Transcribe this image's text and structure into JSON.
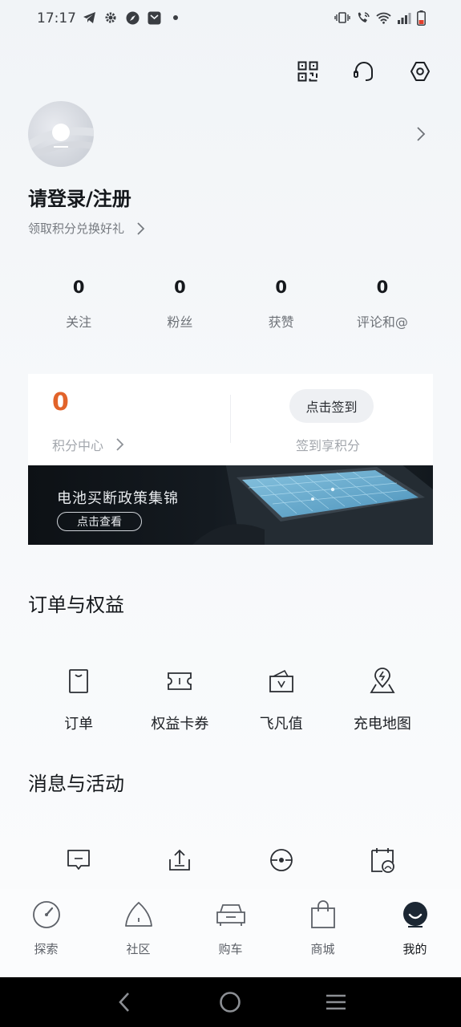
{
  "status_bar": {
    "time": "17:17",
    "left_icons": [
      "telegram-icon",
      "gear-icon",
      "compass-icon",
      "mail-icon",
      "dot-icon"
    ],
    "right_icons": [
      "vibrate-icon",
      "wifi-call-icon",
      "wifi-icon",
      "signal-icon",
      "battery-icon"
    ]
  },
  "top_actions": [
    "qr-code-icon",
    "headset-icon",
    "settings-icon"
  ],
  "profile": {
    "login_label": "请登录/注册",
    "points_link": "领取积分兑换好礼"
  },
  "stats": [
    {
      "value": "0",
      "label": "关注"
    },
    {
      "value": "0",
      "label": "粉丝"
    },
    {
      "value": "0",
      "label": "获赞"
    },
    {
      "value": "0",
      "label": "评论和@"
    }
  ],
  "points_card": {
    "points": "0",
    "center_label": "积分中心",
    "checkin_button": "点击签到",
    "checkin_hint": "签到享积分",
    "points_color": "#e2632a"
  },
  "banner": {
    "title": "电池买断政策集锦",
    "button": "点击查看"
  },
  "orders_section": {
    "title": "订单与权益",
    "items": [
      {
        "label": "订单",
        "icon": "order-icon"
      },
      {
        "label": "权益卡券",
        "icon": "coupon-icon"
      },
      {
        "label": "飞凡值",
        "icon": "wallet-icon"
      },
      {
        "label": "充电地图",
        "icon": "charging-map-icon"
      }
    ]
  },
  "messages_section": {
    "title": "消息与活动",
    "items": [
      {
        "icon": "message-icon"
      },
      {
        "icon": "share-icon"
      },
      {
        "icon": "steering-wheel-icon"
      },
      {
        "icon": "calendar-icon"
      }
    ]
  },
  "bottom_nav": [
    {
      "label": "探索",
      "icon": "explore-icon"
    },
    {
      "label": "社区",
      "icon": "community-icon"
    },
    {
      "label": "购车",
      "icon": "car-icon"
    },
    {
      "label": "商城",
      "icon": "shopping-bag-icon"
    },
    {
      "label": "我的",
      "icon": "profile-icon",
      "active": true
    }
  ]
}
